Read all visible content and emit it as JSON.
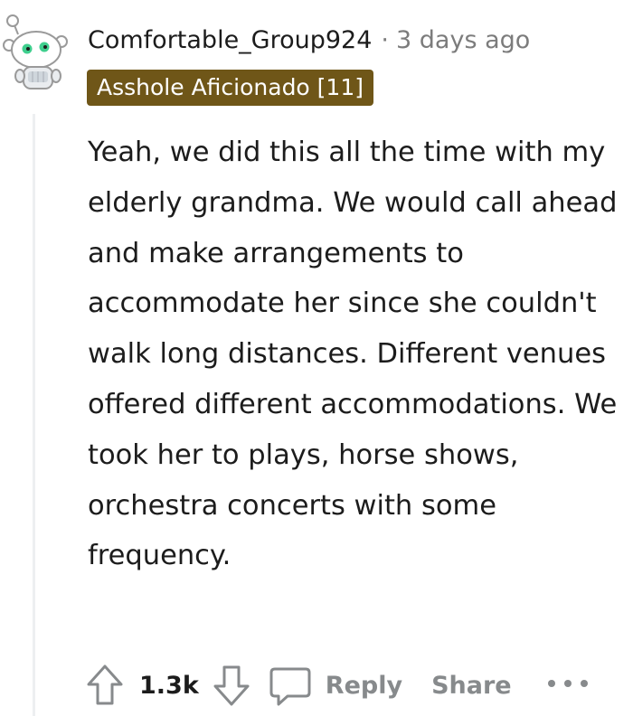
{
  "comment": {
    "author": "Comfortable_Group924",
    "separator": "·",
    "timestamp": "3 days ago",
    "flair": "Asshole Aficionado [11]",
    "body": "Yeah, we did this all the time with my elderly grandma. We would call ahead and make arrangements to accommodate her since she couldn't walk long distances. Different venues offered different accommodations. We took her to plays, horse shows, orchestra concerts with some frequency."
  },
  "actions": {
    "score": "1.3k",
    "reply_label": "Reply",
    "share_label": "Share",
    "upvote_icon": "arrow-up-outline",
    "downvote_icon": "arrow-down-outline",
    "reply_icon": "speech-bubble-outline",
    "more_icon": "horizontal-ellipsis"
  },
  "colors": {
    "flair_background": "#6f5618",
    "flair_text": "#ffffff",
    "text_primary": "#1c1c1c",
    "text_muted": "#7c7c7c",
    "action_gray": "#878a8c",
    "snoo_eye_green": "#3fcf8e"
  }
}
